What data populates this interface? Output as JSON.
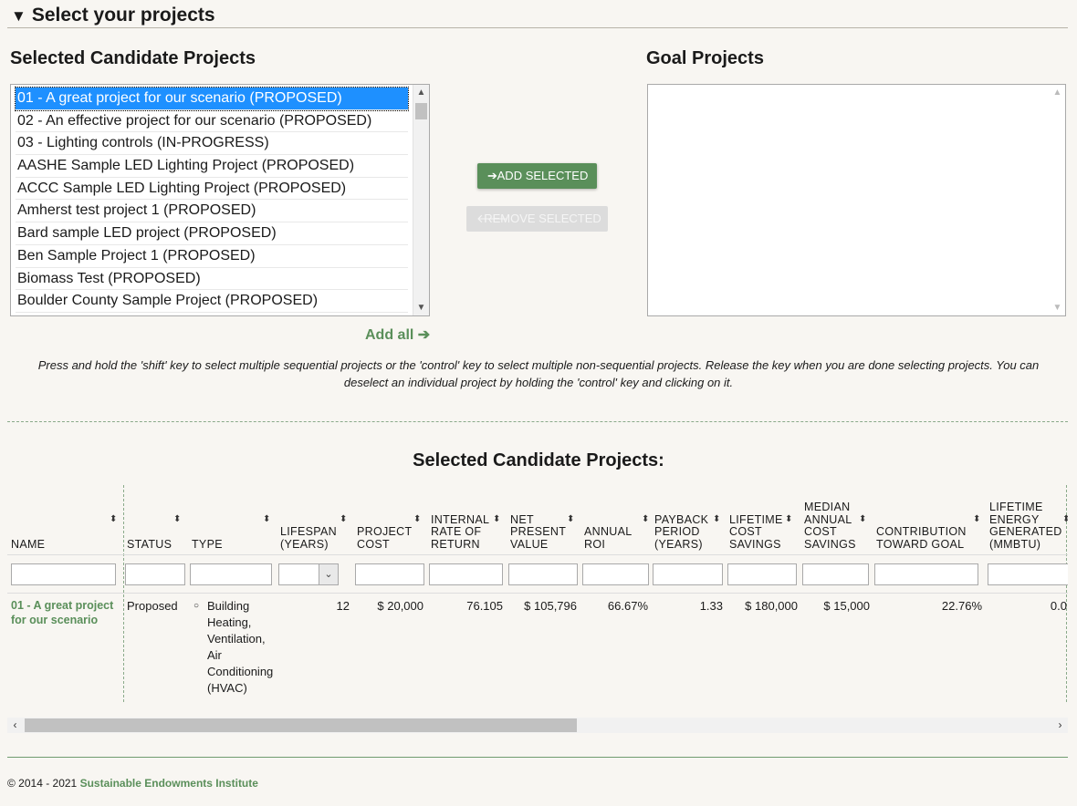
{
  "section": {
    "toggle": "▼",
    "title": "Select your projects"
  },
  "left": {
    "title": "Selected Candidate Projects",
    "options": [
      "01 - A great project for our scenario (PROPOSED)",
      "02 - An effective project for our scenario (PROPOSED)",
      "03 - Lighting controls (IN-PROGRESS)",
      "AASHE Sample LED Lighting Project (PROPOSED)",
      "ACCC Sample LED Lighting Project (PROPOSED)",
      "Amherst test project 1 (PROPOSED)",
      "Bard sample LED project (PROPOSED)",
      "Ben Sample Project 1 (PROPOSED)",
      "Biomass Test (PROPOSED)",
      "Boulder County Sample Project (PROPOSED)"
    ],
    "selected_index": 0
  },
  "right": {
    "title": "Goal Projects"
  },
  "buttons": {
    "add": "ADD SELECTED",
    "remove": "REMOVE SELECTED",
    "add_all": "Add all"
  },
  "hint": "Press and hold the 'shift' key to select multiple sequential projects or the 'control' key to select multiple non-sequential projects. Release the key when you are done selecting projects. You can deselect an individual project by holding the 'control' key and clicking on it.",
  "table": {
    "title": "Selected Candidate Projects:",
    "columns": [
      "NAME",
      "STATUS",
      "TYPE",
      "LIFESPAN (YEARS)",
      "PROJECT COST",
      "INTERNAL RATE OF RETURN",
      "NET PRESENT VALUE",
      "ANNUAL ROI",
      "PAYBACK PERIOD (YEARS)",
      "LIFETIME COST SAVINGS",
      "MEDIAN ANNUAL COST SAVINGS",
      "CONTRIBUTION TOWARD GOAL",
      "LIFETIME ENERGY GENERATED (MMBTU)"
    ],
    "rows": [
      {
        "name": "01 - A great project for our scenario",
        "status": "Proposed",
        "type": "Building Heating, Ventilation, Air Conditioning (HVAC)",
        "lifespan": "12",
        "cost": "$ 20,000",
        "irr": "76.105",
        "npv": "$ 105,796",
        "roi": "66.67%",
        "payback": "1.33",
        "lifetime_savings": "$ 180,000",
        "median_savings": "$ 15,000",
        "contribution": "22.76%",
        "energy": "0.0"
      }
    ]
  },
  "footer": {
    "copyright": "© 2014 - 2021",
    "org": "Sustainable Endowments Institute"
  }
}
